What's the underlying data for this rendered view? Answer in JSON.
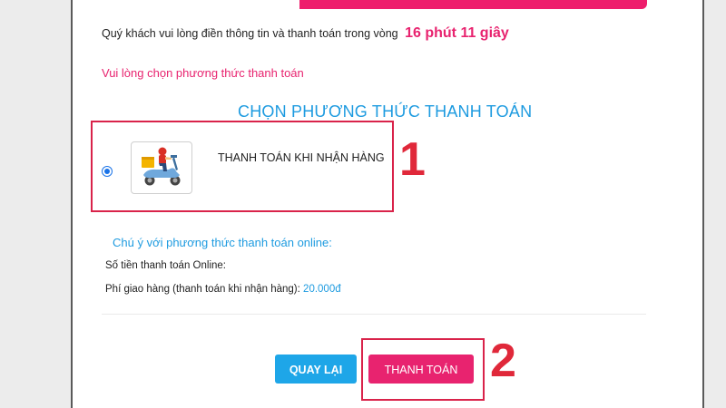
{
  "header": {
    "notice_text": "Quý khách vui lòng điền thông tin và thanh toán trong vòng",
    "timer": "16 phút 11 giây"
  },
  "prompt": "Vui lòng chọn phương thức thanh toán",
  "section_title": "CHỌN PHƯƠNG THỨC THANH TOÁN",
  "payment_methods": [
    {
      "label": "THANH TOÁN KHI NHẬN HÀNG",
      "selected": true,
      "icon": "delivery-scooter-icon"
    }
  ],
  "online_note": {
    "title": "Chú ý với phương thức thanh toán online:",
    "online_amount_label": "Số tiền thanh toán Online:",
    "online_amount_value": "",
    "fee_label": "Phí giao hàng (thanh toán khi nhận hàng):",
    "fee_value": "20.000đ"
  },
  "buttons": {
    "back": "QUAY LẠI",
    "pay": "THANH TOÁN"
  },
  "annotations": {
    "step1": "1",
    "step2": "2",
    "color": "#e0283a"
  },
  "colors": {
    "accent_pink": "#e8236f",
    "accent_blue": "#1e9be0"
  }
}
